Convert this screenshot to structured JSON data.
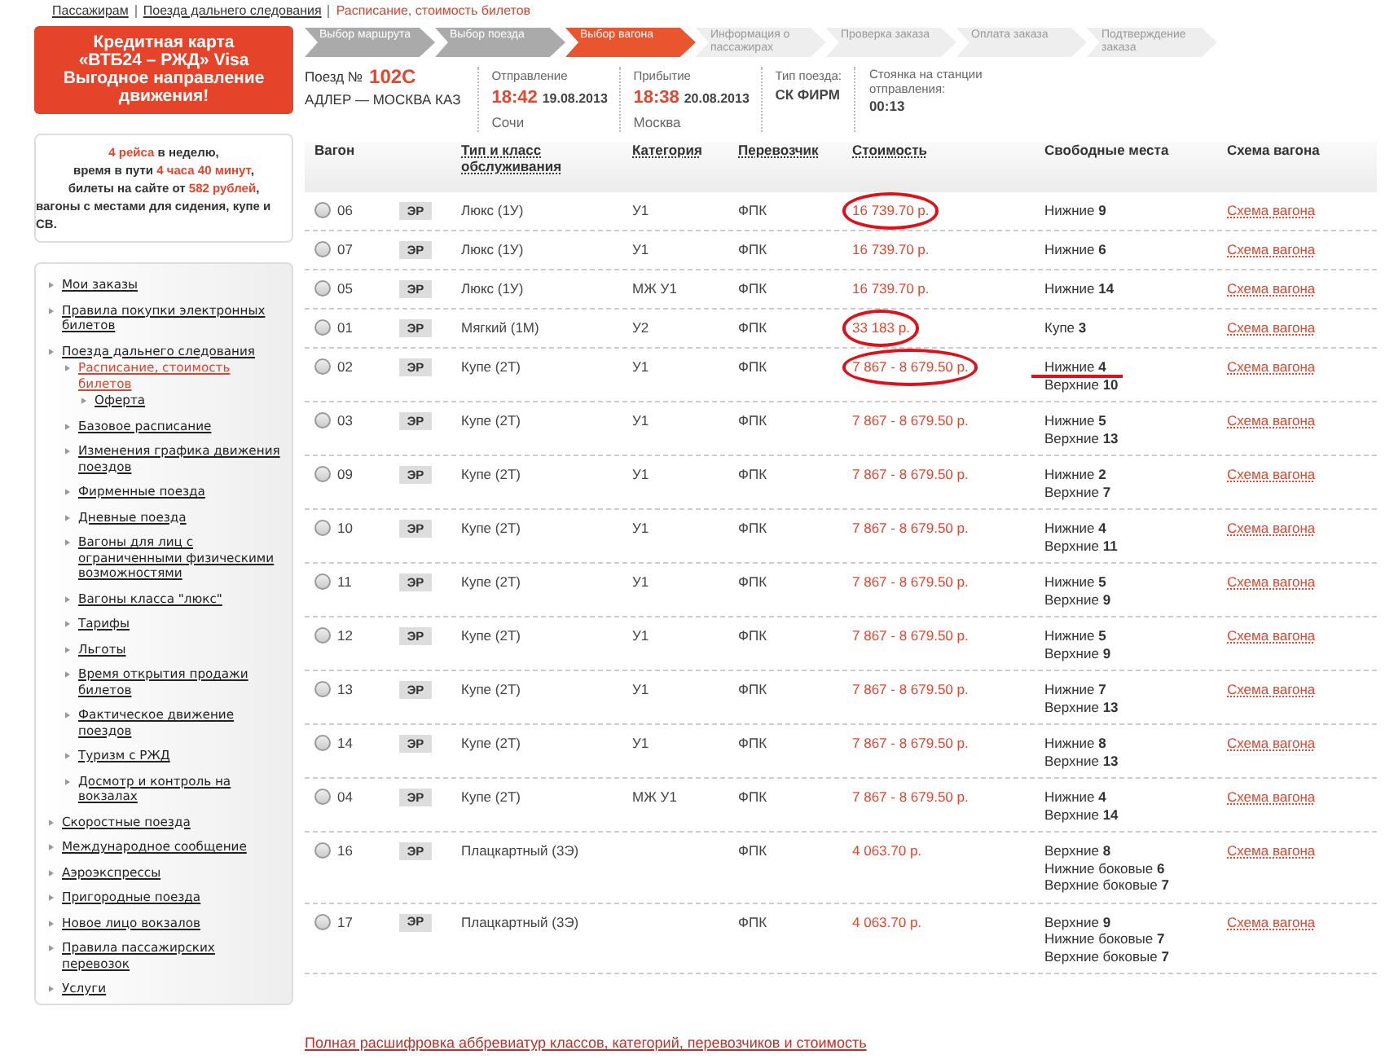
{
  "breadcrumbs": [
    {
      "label": "Пассажирам",
      "selected": false
    },
    {
      "label": "Поезда дальнего следования",
      "selected": false
    },
    {
      "label": "Расписание, стоимость билетов",
      "selected": true
    }
  ],
  "promo": {
    "lines": [
      "Кредитная карта",
      "«ВТБ24 – РЖД» Visa",
      "Выгодное направление",
      "движения!"
    ]
  },
  "info": {
    "lines": [
      [
        {
          "text": "4 рейса",
          "highlight": true
        },
        {
          "text": " в неделю,",
          "highlight": false
        }
      ],
      [
        {
          "text": "время в пути ",
          "highlight": false
        },
        {
          "text": "4 часа 40 минут",
          "highlight": true
        },
        {
          "text": ",",
          "highlight": false
        }
      ],
      [
        {
          "text": "билеты на сайте от ",
          "highlight": false
        },
        {
          "text": "582 рублей",
          "highlight": true
        },
        {
          "text": ",",
          "highlight": false
        }
      ],
      [
        {
          "text": "вагоны с местами для сидения, купе и СВ.",
          "highlight": false
        }
      ]
    ]
  },
  "sidebar": {
    "items": [
      {
        "label": "Мои заказы",
        "selected": false
      },
      {
        "label": "Правила покупки электронных билетов",
        "selected": false
      },
      {
        "label": "Поезда дальнего следования",
        "selected": false,
        "children": [
          {
            "label": "Расписание, стоимость билетов",
            "selected": true,
            "children": [
              {
                "label": "Оферта",
                "selected": false
              }
            ]
          },
          {
            "label": "Базовое расписание",
            "selected": false
          },
          {
            "label": "Изменения графика движения поездов",
            "selected": false
          },
          {
            "label": "Фирменные поезда",
            "selected": false
          },
          {
            "label": "Дневные поезда",
            "selected": false
          },
          {
            "label": "Вагоны для лиц с ограниченными физическими возможностями",
            "selected": false
          },
          {
            "label": "Вагоны класса \"люкс\"",
            "selected": false
          },
          {
            "label": "Тарифы",
            "selected": false
          },
          {
            "label": "Льготы",
            "selected": false
          },
          {
            "label": "Время открытия продажи билетов",
            "selected": false
          },
          {
            "label": "Фактическое движение поездов",
            "selected": false
          },
          {
            "label": "Туризм с РЖД",
            "selected": false
          },
          {
            "label": "Досмотр и контроль на вокзалах",
            "selected": false
          }
        ]
      },
      {
        "label": "Скоростные поезда",
        "selected": false
      },
      {
        "label": "Международное сообщение",
        "selected": false
      },
      {
        "label": "Аэроэкспрессы",
        "selected": false
      },
      {
        "label": "Пригородные поезда",
        "selected": false
      },
      {
        "label": "Новое лицо вокзалов",
        "selected": false
      },
      {
        "label": "Правила пассажирских перевозок",
        "selected": false
      },
      {
        "label": "Услуги",
        "selected": false
      }
    ]
  },
  "steps": [
    {
      "label": "Выбор маршрута",
      "selected": false,
      "done": true
    },
    {
      "label": "Выбор поезда",
      "selected": false,
      "done": true
    },
    {
      "label": "Выбор вагона",
      "selected": true,
      "done": false
    },
    {
      "label": "Информация о пассажирах",
      "selected": false,
      "done": false
    },
    {
      "label": "Проверка заказа",
      "selected": false,
      "done": false
    },
    {
      "label": "Оплата заказа",
      "selected": false,
      "done": false
    },
    {
      "label": "Подтверждение заказа",
      "selected": false,
      "done": false
    }
  ],
  "train": {
    "number_label": "Поезд №",
    "number": "102С",
    "route": "АДЛЕР — МОСКВА КАЗ",
    "departure": {
      "label": "Отправление",
      "time": "18:42",
      "date": "19.08.2013",
      "station": "Сочи"
    },
    "arrival": {
      "label": "Прибытие",
      "time": "18:38",
      "date": "20.08.2013",
      "station": "Москва"
    },
    "type": {
      "label": "Тип поезда:",
      "value": "СК ФИРМ"
    },
    "stop": {
      "label": "Стоянка на станции отправления:",
      "value": "00:13"
    }
  },
  "table": {
    "columns": [
      {
        "label": "Вагон",
        "sortable": false
      },
      {
        "label": "Тип и класс обслуживания",
        "sortable": true
      },
      {
        "label": "Категория",
        "sortable": true
      },
      {
        "label": "Перевозчик",
        "sortable": true
      },
      {
        "label": "Стоимость",
        "sortable": true
      },
      {
        "label": "Свободные места",
        "sortable": false
      },
      {
        "label": "Схема вагона",
        "sortable": false
      }
    ],
    "rows": [
      {
        "car": "06",
        "selected": false,
        "badge": "ЭР",
        "class": "Люкс (1У)",
        "category": "У1",
        "carrier": "ФПК",
        "price": "16 739.70 р.",
        "price_circled": true,
        "seats_underlined": false,
        "seats": [
          {
            "label": "Нижние",
            "count": "9"
          }
        ],
        "scheme": "Схема вагона"
      },
      {
        "car": "07",
        "selected": false,
        "badge": "ЭР",
        "class": "Люкс (1У)",
        "category": "У1",
        "carrier": "ФПК",
        "price": "16 739.70 р.",
        "price_circled": false,
        "seats_underlined": false,
        "seats": [
          {
            "label": "Нижние",
            "count": "6"
          }
        ],
        "scheme": "Схема вагона"
      },
      {
        "car": "05",
        "selected": false,
        "badge": "ЭР",
        "class": "Люкс (1У)",
        "category": "МЖ У1",
        "carrier": "ФПК",
        "price": "16 739.70 р.",
        "price_circled": false,
        "seats_underlined": false,
        "seats": [
          {
            "label": "Нижние",
            "count": "14"
          }
        ],
        "scheme": "Схема вагона"
      },
      {
        "car": "01",
        "selected": false,
        "badge": "ЭР",
        "class": "Мягкий (1М)",
        "category": "У2",
        "carrier": "ФПК",
        "price": "33 183 р.",
        "price_circled": true,
        "seats_underlined": false,
        "seats": [
          {
            "label": "Купе",
            "count": "3"
          }
        ],
        "scheme": "Схема вагона"
      },
      {
        "car": "02",
        "selected": false,
        "badge": "ЭР",
        "class": "Купе (2Т)",
        "category": "У1",
        "carrier": "ФПК",
        "price": "7 867 - 8 679.50 р.",
        "price_circled": true,
        "seats_underlined": true,
        "seats": [
          {
            "label": "Нижние",
            "count": "4"
          },
          {
            "label": "Верхние",
            "count": "10"
          }
        ],
        "scheme": "Схема вагона"
      },
      {
        "car": "03",
        "selected": false,
        "badge": "ЭР",
        "class": "Купе (2Т)",
        "category": "У1",
        "carrier": "ФПК",
        "price": "7 867 - 8 679.50 р.",
        "price_circled": false,
        "seats_underlined": false,
        "seats": [
          {
            "label": "Нижние",
            "count": "5"
          },
          {
            "label": "Верхние",
            "count": "13"
          }
        ],
        "scheme": "Схема вагона"
      },
      {
        "car": "09",
        "selected": false,
        "badge": "ЭР",
        "class": "Купе (2Т)",
        "category": "У1",
        "carrier": "ФПК",
        "price": "7 867 - 8 679.50 р.",
        "price_circled": false,
        "seats_underlined": false,
        "seats": [
          {
            "label": "Нижние",
            "count": "2"
          },
          {
            "label": "Верхние",
            "count": "7"
          }
        ],
        "scheme": "Схема вагона"
      },
      {
        "car": "10",
        "selected": false,
        "badge": "ЭР",
        "class": "Купе (2Т)",
        "category": "У1",
        "carrier": "ФПК",
        "price": "7 867 - 8 679.50 р.",
        "price_circled": false,
        "seats_underlined": false,
        "seats": [
          {
            "label": "Нижние",
            "count": "4"
          },
          {
            "label": "Верхние",
            "count": "11"
          }
        ],
        "scheme": "Схема вагона"
      },
      {
        "car": "11",
        "selected": false,
        "badge": "ЭР",
        "class": "Купе (2Т)",
        "category": "У1",
        "carrier": "ФПК",
        "price": "7 867 - 8 679.50 р.",
        "price_circled": false,
        "seats_underlined": false,
        "seats": [
          {
            "label": "Нижние",
            "count": "5"
          },
          {
            "label": "Верхние",
            "count": "9"
          }
        ],
        "scheme": "Схема вагона"
      },
      {
        "car": "12",
        "selected": false,
        "badge": "ЭР",
        "class": "Купе (2Т)",
        "category": "У1",
        "carrier": "ФПК",
        "price": "7 867 - 8 679.50 р.",
        "price_circled": false,
        "seats_underlined": false,
        "seats": [
          {
            "label": "Нижние",
            "count": "5"
          },
          {
            "label": "Верхние",
            "count": "9"
          }
        ],
        "scheme": "Схема вагона"
      },
      {
        "car": "13",
        "selected": false,
        "badge": "ЭР",
        "class": "Купе (2Т)",
        "category": "У1",
        "carrier": "ФПК",
        "price": "7 867 - 8 679.50 р.",
        "price_circled": false,
        "seats_underlined": false,
        "seats": [
          {
            "label": "Нижние",
            "count": "7"
          },
          {
            "label": "Верхние",
            "count": "13"
          }
        ],
        "scheme": "Схема вагона"
      },
      {
        "car": "14",
        "selected": false,
        "badge": "ЭР",
        "class": "Купе (2Т)",
        "category": "У1",
        "carrier": "ФПК",
        "price": "7 867 - 8 679.50 р.",
        "price_circled": false,
        "seats_underlined": false,
        "seats": [
          {
            "label": "Нижние",
            "count": "8"
          },
          {
            "label": "Верхние",
            "count": "13"
          }
        ],
        "scheme": "Схема вагона"
      },
      {
        "car": "04",
        "selected": false,
        "badge": "ЭР",
        "class": "Купе (2Т)",
        "category": "МЖ У1",
        "carrier": "ФПК",
        "price": "7 867 - 8 679.50 р.",
        "price_circled": false,
        "seats_underlined": false,
        "seats": [
          {
            "label": "Нижние",
            "count": "4"
          },
          {
            "label": "Верхние",
            "count": "14"
          }
        ],
        "scheme": "Схема вагона"
      },
      {
        "car": "16",
        "selected": false,
        "badge": "ЭР",
        "class": "Плацкартный (3Э)",
        "carrier": "ФПК",
        "price": "4 063.70 р.",
        "price_circled": false,
        "seats_underlined": false,
        "seats": [
          {
            "label": "Верхние",
            "count": "8"
          },
          {
            "label": "Нижние боковые",
            "count": "6"
          },
          {
            "label": "Верхние боковые",
            "count": "7"
          }
        ],
        "scheme": "Схема вагона"
      },
      {
        "car": "17",
        "selected": false,
        "badge": "ЭР",
        "class": "Плацкартный (3Э)",
        "carrier": "ФПК",
        "price": "4 063.70 р.",
        "price_circled": false,
        "seats_underlined": false,
        "seats": [
          {
            "label": "Верхние",
            "count": "9"
          },
          {
            "label": "Нижние боковые",
            "count": "7"
          },
          {
            "label": "Верхние боковые",
            "count": "7"
          }
        ],
        "scheme": "Схема вагона"
      }
    ]
  },
  "footer_link": "Полная расшифровка аббревиатур классов, категорий, перевозчиков и стоимость"
}
